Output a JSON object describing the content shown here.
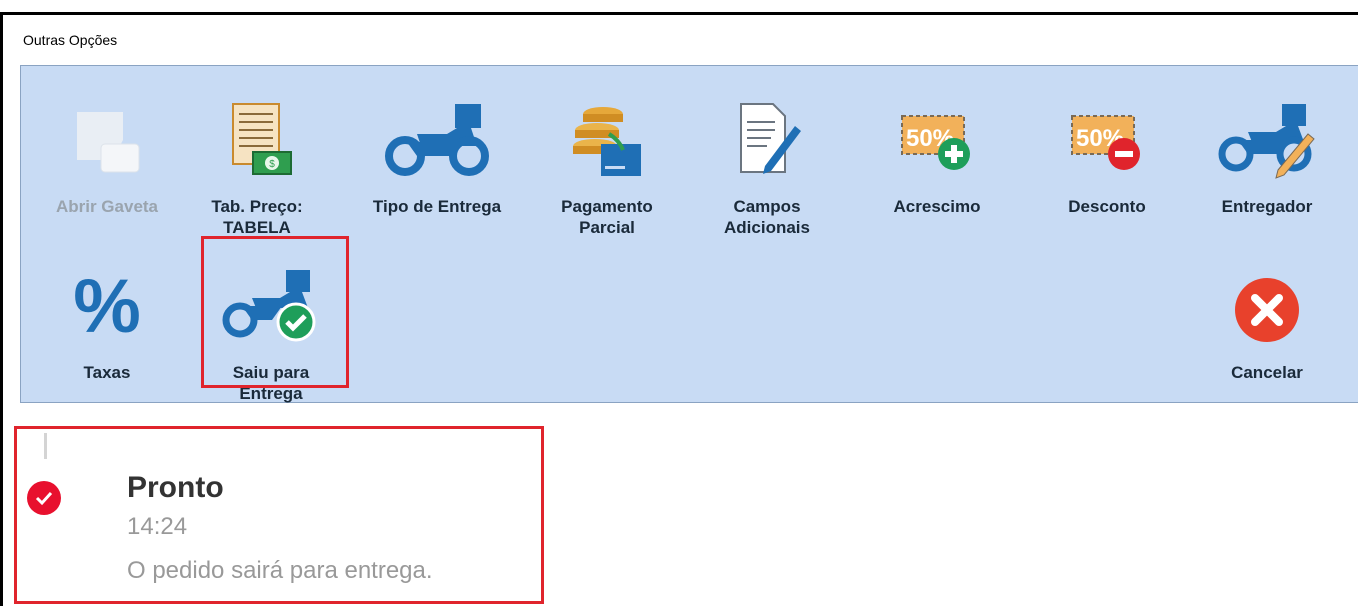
{
  "window": {
    "title": "Outras Opções"
  },
  "toolbar": {
    "row1": [
      {
        "label": "Abrir Gaveta",
        "icon": "cash-drawer-icon",
        "enabled": false
      },
      {
        "label": "Tab. Preço:\nTABELA",
        "icon": "price-table-icon",
        "enabled": true
      },
      {
        "label": "Tipo de Entrega",
        "icon": "delivery-motorcycle-icon",
        "enabled": true
      },
      {
        "label": "Pagamento\nParcial",
        "icon": "partial-payment-icon",
        "enabled": true
      },
      {
        "label": "Campos\nAdicionais",
        "icon": "document-edit-icon",
        "enabled": true
      },
      {
        "label": "Acrescimo",
        "icon": "surcharge-50-plus-icon",
        "enabled": true
      },
      {
        "label": "Desconto",
        "icon": "discount-50-minus-icon",
        "enabled": true
      },
      {
        "label": "Entregador",
        "icon": "courier-edit-icon",
        "enabled": true
      }
    ],
    "row2": [
      {
        "label": "Taxas",
        "icon": "percent-icon",
        "enabled": true
      },
      {
        "label": "Saiu para\nEntrega",
        "icon": "delivery-check-icon",
        "enabled": true,
        "highlighted": true
      }
    ],
    "cancel": {
      "label": "Cancelar",
      "icon": "cancel-x-icon"
    },
    "badge_text": "50%"
  },
  "status": {
    "title": "Pronto",
    "time": "14:24",
    "description": "O pedido sairá para entrega."
  },
  "colors": {
    "accent_blue": "#1f6fb5",
    "highlight_red": "#e0242c",
    "panel_bg": "#c8dbf4",
    "cancel_red": "#e8412c",
    "check_green": "#1e9e5a"
  }
}
